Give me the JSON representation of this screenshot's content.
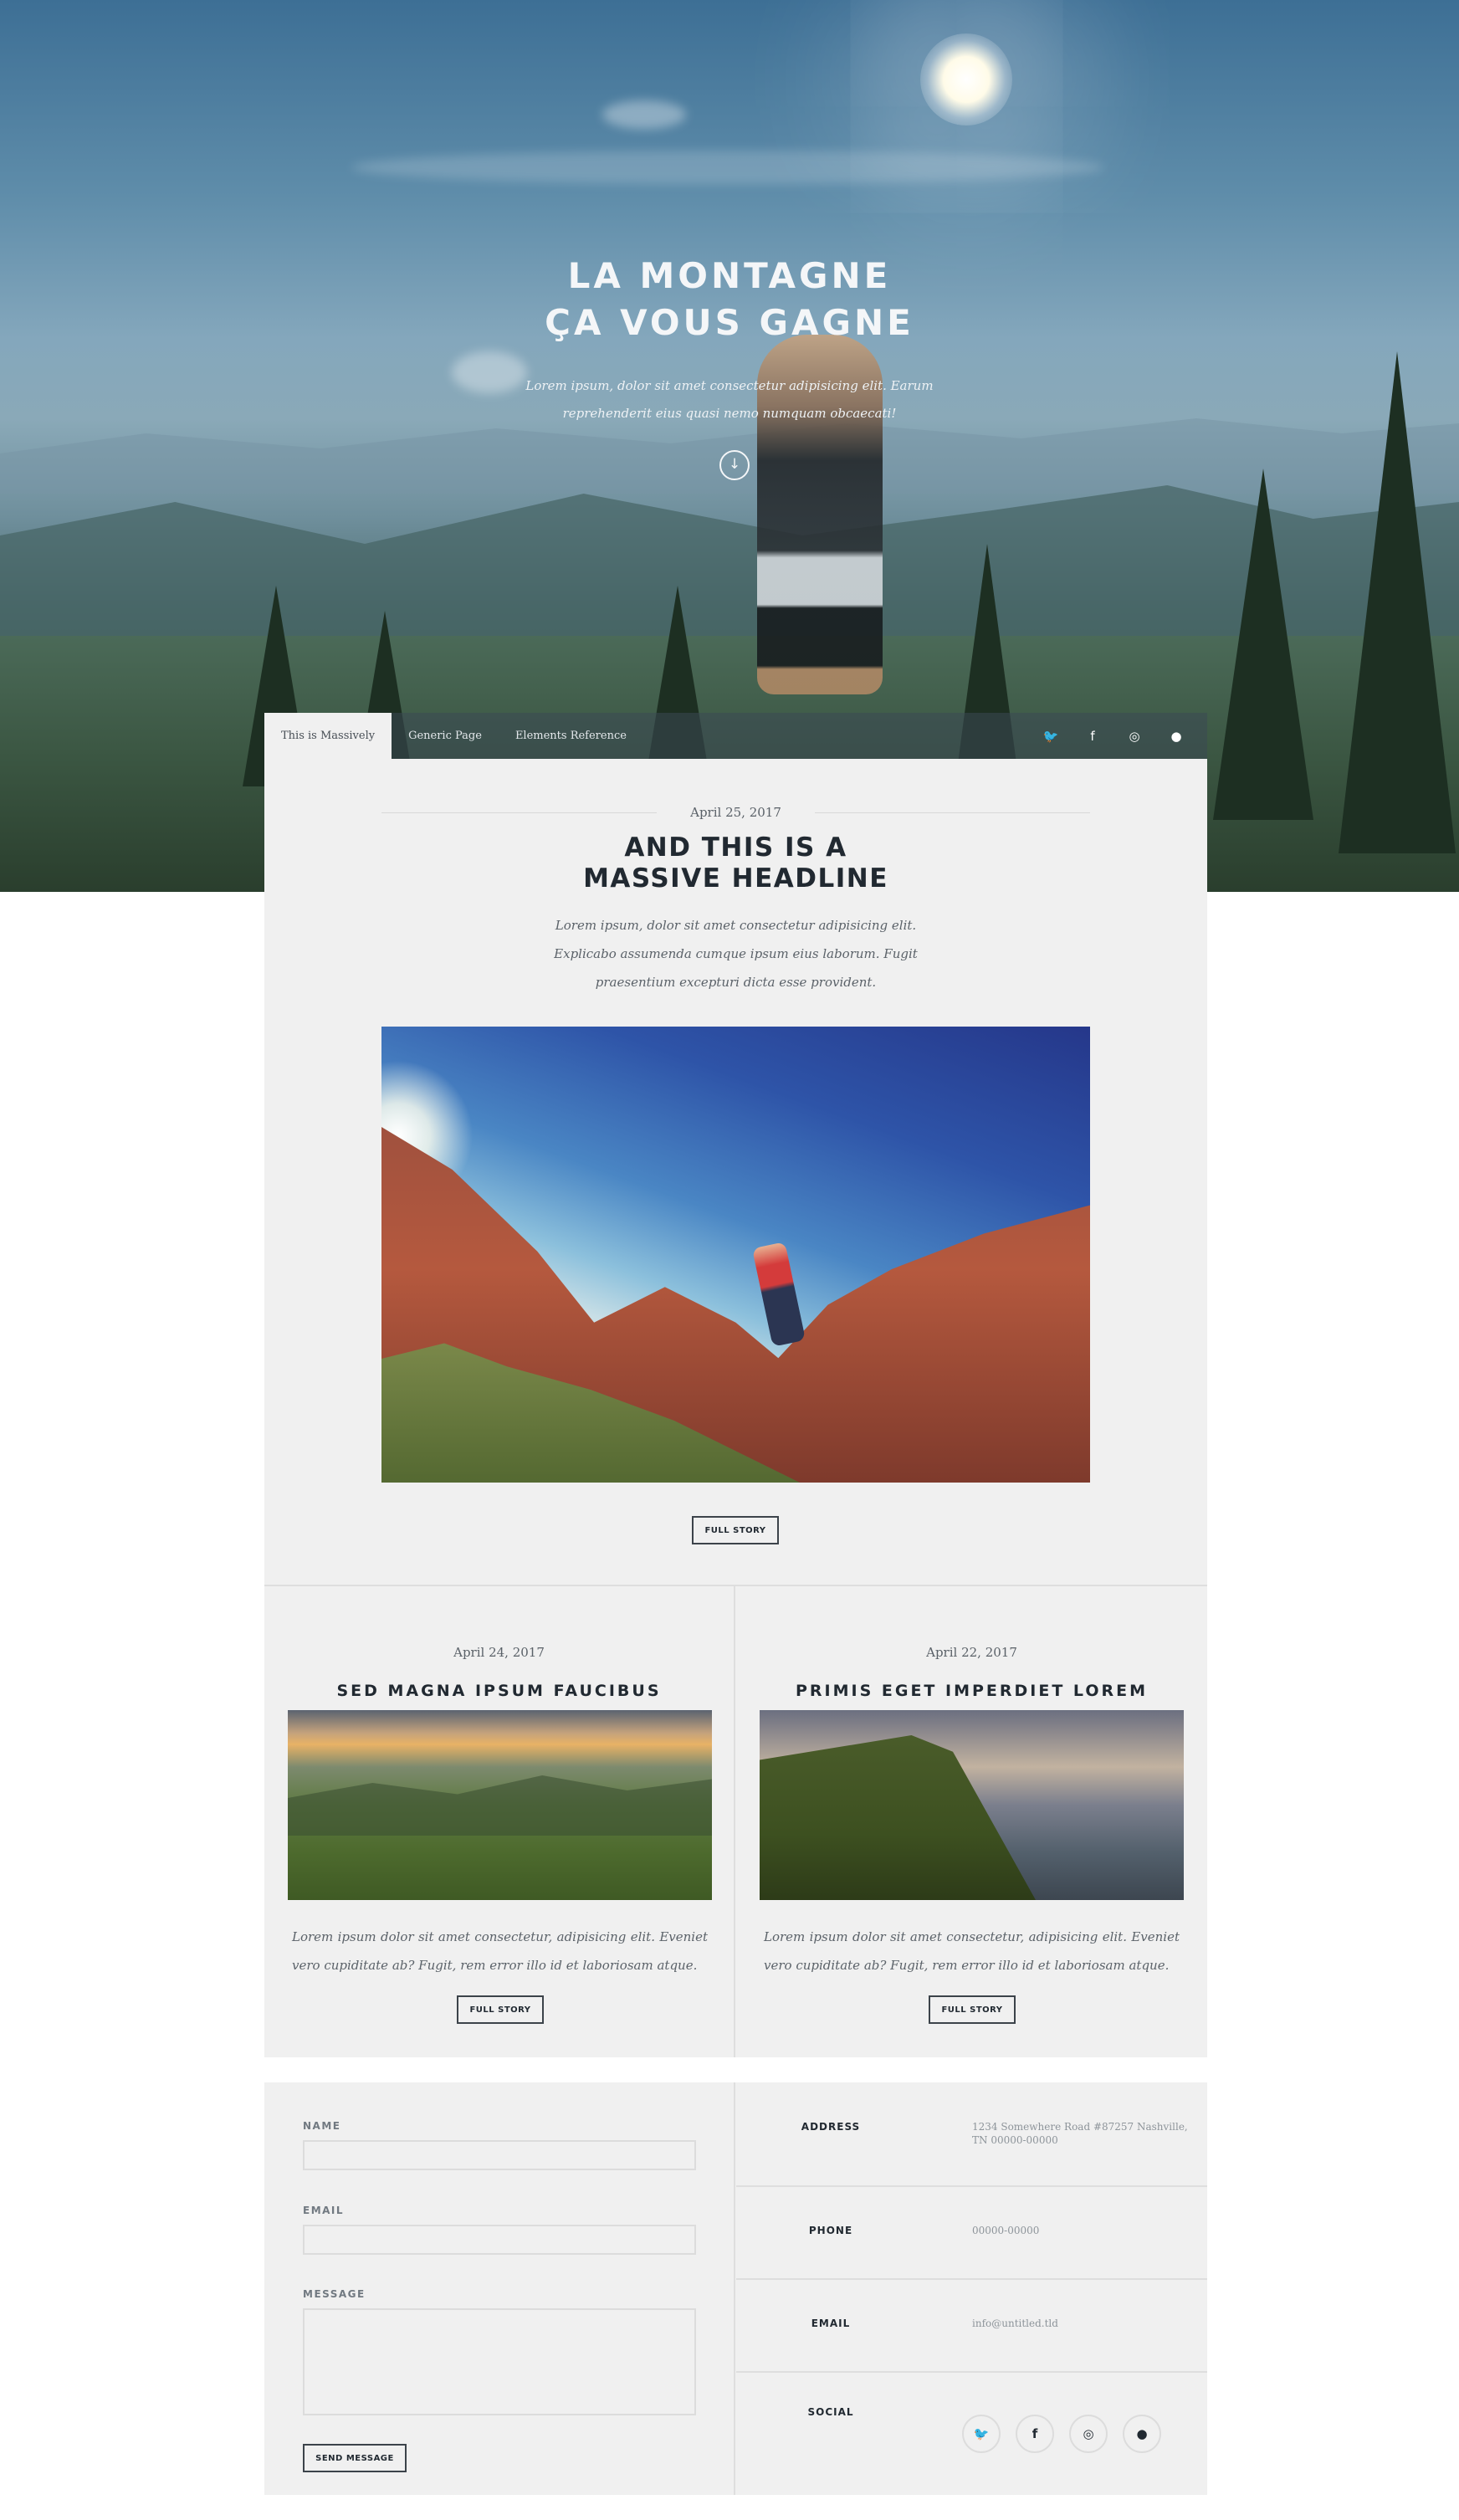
{
  "hero": {
    "title_line1": "LA MONTAGNE",
    "title_line2": "ÇA VOUS GAGNE",
    "subtitle_line1": "Lorem ipsum, dolor sit amet consectetur adipisicing elit. Earum",
    "subtitle_line2": "reprehenderit eius quasi nemo numquam obcaecati!",
    "scroll_icon": "arrow-down-circle"
  },
  "nav": {
    "items": [
      {
        "label": "This is Massively"
      },
      {
        "label": "Generic Page"
      },
      {
        "label": "Elements Reference"
      }
    ],
    "icons": [
      {
        "name": "twitter",
        "glyph": "🐦"
      },
      {
        "name": "facebook",
        "glyph": "f"
      },
      {
        "name": "instagram",
        "glyph": "◎"
      },
      {
        "name": "github",
        "glyph": "●"
      }
    ]
  },
  "featured": {
    "date": "April 25, 2017",
    "title_line1": "AND THIS IS A",
    "title_line2": "MASSIVE HEADLINE",
    "text_line1": "Lorem ipsum, dolor sit amet consectetur adipisicing elit.",
    "text_line2": "Explicabo assumenda cumque ipsum eius laborum. Fugit",
    "text_line3": "praesentium excepturi dicta esse provident.",
    "button": "FULL STORY"
  },
  "posts": [
    {
      "date": "April 24, 2017",
      "title": "SED MAGNA IPSUM FAUCIBUS",
      "text": "Lorem ipsum dolor sit amet consectetur, adipisicing elit. Eveniet vero cupiditate ab? Fugit, rem error illo id et laboriosam atque.",
      "button": "FULL STORY"
    },
    {
      "date": "April 22, 2017",
      "title": "PRIMIS EGET IMPERDIET LOREM",
      "text": "Lorem ipsum dolor sit amet consectetur, adipisicing elit. Eveniet vero cupiditate ab? Fugit, rem error illo id et laboriosam atque.",
      "button": "FULL STORY"
    }
  ],
  "contact": {
    "name_label": "NAME",
    "email_label": "EMAIL",
    "message_label": "MESSAGE",
    "send_button": "SEND MESSAGE",
    "address_label": "ADDRESS",
    "address_value": "1234 Somewhere Road #87257 Nashville, TN 00000-00000",
    "phone_label": "PHONE",
    "phone_value": "00000-00000",
    "email_info_label": "EMAIL",
    "email_value": "info@untitled.tld",
    "social_label": "SOCIAL",
    "social_icons": [
      {
        "name": "twitter",
        "glyph": "🐦"
      },
      {
        "name": "facebook",
        "glyph": "f"
      },
      {
        "name": "instagram",
        "glyph": "◎"
      },
      {
        "name": "github",
        "glyph": "●"
      }
    ]
  }
}
